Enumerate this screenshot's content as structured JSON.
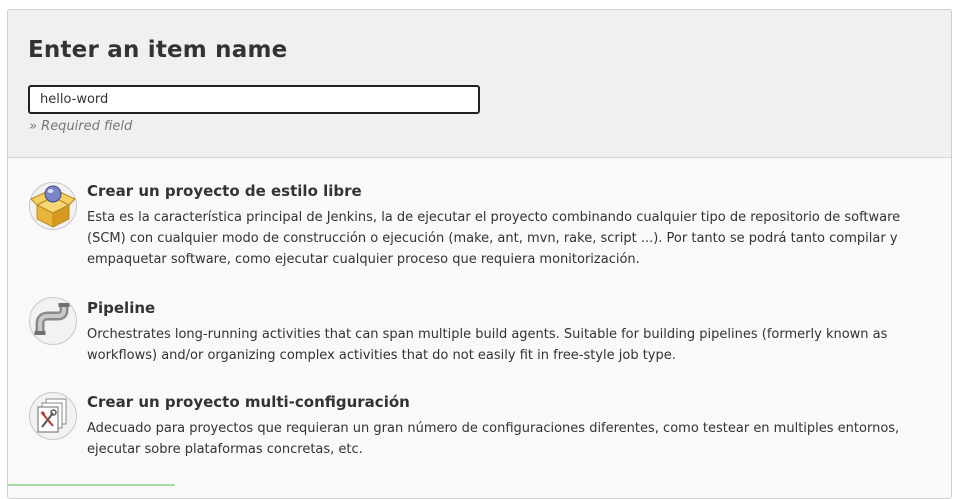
{
  "header": {
    "title": "Enter an item name",
    "item_name_value": "hello-word",
    "required_note": "» Required field"
  },
  "items": [
    {
      "title": "Crear un proyecto de estilo libre",
      "description": "Esta es la característica principal de Jenkins, la de ejecutar el proyecto combinando cualquier tipo de repositorio de software (SCM) con cualquier modo de construcción o ejecución (make, ant, mvn, rake, script ...). Por tanto se podrá tanto compilar y empaquetar software, como ejecutar cualquier proceso que requiera monitorización.",
      "icon": "freestyle-package-icon"
    },
    {
      "title": "Pipeline",
      "description": "Orchestrates long-running activities that can span multiple build agents. Suitable for building pipelines (formerly known as workflows) and/or organizing complex activities that do not easily fit in free-style job type.",
      "icon": "pipeline-pipe-icon"
    },
    {
      "title": "Crear un proyecto multi-configuración",
      "description": "Adecuado para proyectos que requieran un gran número de configuraciones diferentes, como testear en multiples entornos, ejecutar sobre plataformas concretas, etc.",
      "icon": "multi-configuration-icon"
    }
  ]
}
